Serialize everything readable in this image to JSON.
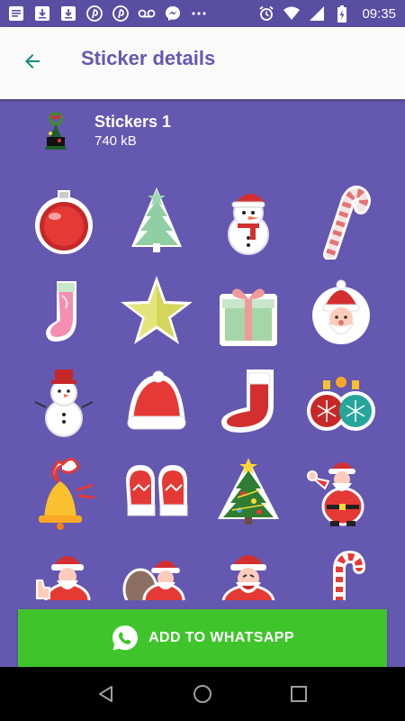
{
  "status_bar": {
    "time": "09:35",
    "left_icons": [
      "message-icon",
      "download-icon",
      "download-icon",
      "pinterest-icon",
      "pinterest-icon",
      "voicemail-icon",
      "messenger-icon",
      "more-dots-icon"
    ],
    "right_icons": [
      "alarm-icon",
      "wifi-icon",
      "signal-icon",
      "battery-charging-icon"
    ]
  },
  "app_bar": {
    "title": "Sticker details",
    "back_icon": "arrow-back-icon"
  },
  "pack": {
    "name": "Stickers 1",
    "size": "740 kB",
    "tray_icon": "christmas-wreath-tray-icon"
  },
  "stickers": [
    "red-ornament-sticker",
    "christmas-tree-sticker",
    "snowman-santa-hat-sticker",
    "candy-cane-sticker",
    "christmas-stocking-sticker",
    "star-sticker",
    "gift-box-sticker",
    "santa-face-sticker",
    "snowman-sticker",
    "santa-hat-sticker",
    "red-stocking-sticker",
    "ornaments-pair-sticker",
    "bell-bow-sticker",
    "mittens-sticker",
    "decorated-tree-sticker",
    "santa-waving-sticker",
    "santa-thumbs-up-sticker",
    "santa-sack-sticker",
    "santa-laughing-sticker",
    "candy-cane-small-sticker"
  ],
  "add_button": {
    "label": "ADD TO WHATSAPP",
    "icon": "whatsapp-icon"
  },
  "nav_bar": {
    "buttons": [
      "back-triangle-icon",
      "home-circle-icon",
      "recents-square-icon"
    ]
  },
  "colors": {
    "accent": "#6558b0",
    "status_bar": "#5a4ea3",
    "button": "#3fc52b",
    "app_bar": "#fafafa"
  }
}
